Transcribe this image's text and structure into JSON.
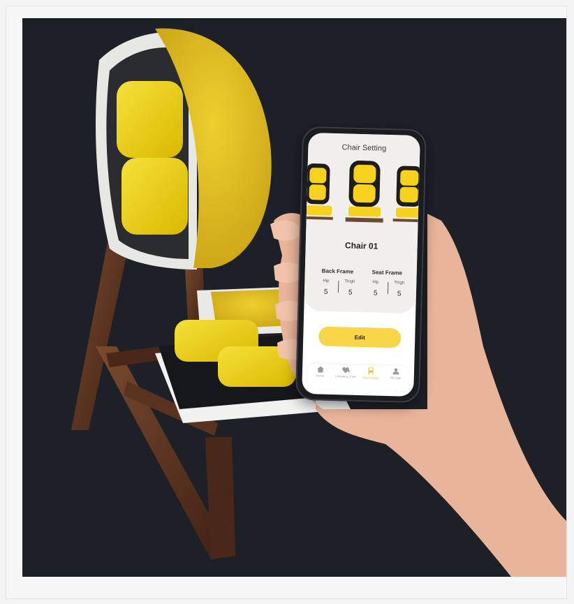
{
  "app": {
    "title": "Chair Setting",
    "selected_chair": "Chair 01",
    "back_frame": {
      "label": "Back Frame",
      "hip_label": "Hip",
      "hip_value": "5",
      "thigh_label": "Thigh",
      "thigh_value": "5"
    },
    "seat_frame": {
      "label": "Seat Frame",
      "hip_label": "Hip",
      "hip_value": "5",
      "thigh_label": "Thigh",
      "thigh_value": "5"
    },
    "edit_label": "Edit",
    "tabs": [
      {
        "label": "Home",
        "icon": "home-icon",
        "active": false
      },
      {
        "label": "Consulting /Care",
        "icon": "heart-plus-icon",
        "active": false
      },
      {
        "label": "Chair Setting",
        "icon": "chair-icon",
        "active": true
      },
      {
        "label": "My page",
        "icon": "person-icon",
        "active": false
      }
    ]
  },
  "colors": {
    "background": "#1d2127",
    "accent": "#f9d548",
    "upholstery": "#e9c31d",
    "wood": "#5a3320",
    "panel": "#f1efeb"
  }
}
